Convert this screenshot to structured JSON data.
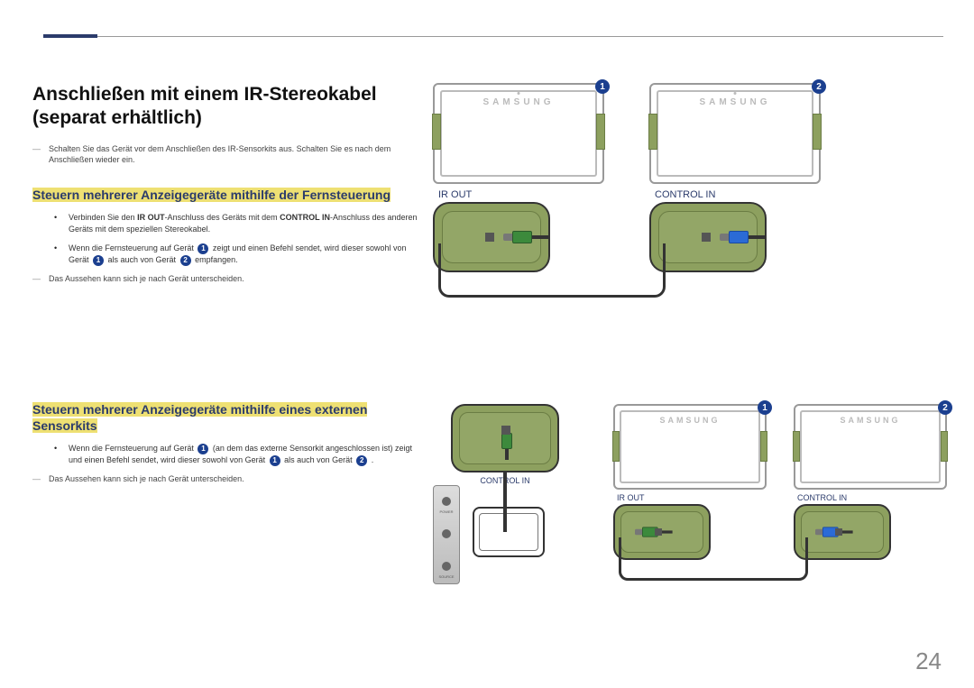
{
  "page_number": "24",
  "title": "Anschließen mit einem IR-Stereokabel (separat erhältlich)",
  "intro_note": "Schalten Sie das Gerät vor dem Anschließen des IR-Sensorkits aus. Schalten Sie es nach dem Anschließen wieder ein.",
  "section1": {
    "heading": "Steuern mehrerer Anzeigegeräte mithilfe der Fernsteuerung",
    "bullet1_pre": "Verbinden Sie den ",
    "bullet1_bold1": "IR OUT",
    "bullet1_mid": "-Anschluss des Geräts mit dem ",
    "bullet1_bold2": "CONTROL IN",
    "bullet1_post": "-Anschluss des anderen Geräts mit dem speziellen Stereokabel.",
    "bullet2_a": "Wenn die Fernsteuerung auf Gerät ",
    "bullet2_b": " zeigt und einen Befehl sendet, wird dieser sowohl von Gerät ",
    "bullet2_c": " als auch von Gerät ",
    "bullet2_d": " empfangen.",
    "note": "Das Aussehen kann sich je nach Gerät unterscheiden."
  },
  "section2": {
    "heading": "Steuern mehrerer Anzeigegeräte mithilfe eines externen Sensorkits",
    "bullet1_a": "Wenn die Fernsteuerung auf Gerät ",
    "bullet1_b": " (an dem das externe Sensorkit angeschlossen ist) zeigt und einen Befehl sendet, wird dieser sowohl von Gerät ",
    "bullet1_c": " als auch von Gerät ",
    "bullet1_d": " .",
    "note": "Das Aussehen kann sich je nach Gerät unterscheiden."
  },
  "labels": {
    "ir_out": "IR OUT",
    "control_in": "CONTROL IN",
    "brand": "SAMSUNG",
    "power": "POWER",
    "source": "SOURCE"
  },
  "badges": {
    "one": "1",
    "two": "2"
  }
}
